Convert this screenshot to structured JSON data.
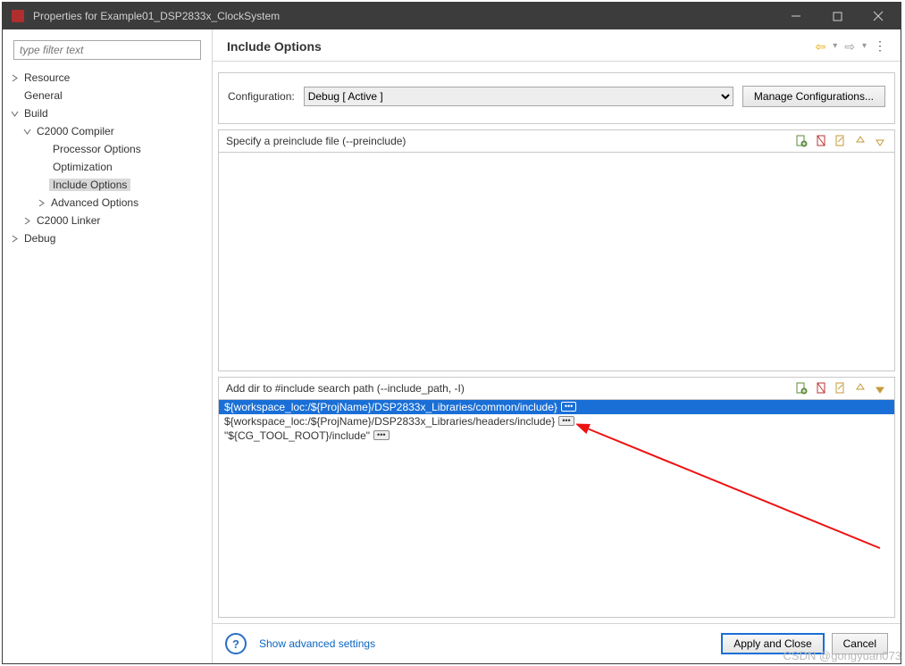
{
  "title": "Properties for Example01_DSP2833x_ClockSystem",
  "filter_placeholder": "type filter text",
  "tree": {
    "resource": "Resource",
    "general": "General",
    "build": "Build",
    "c2000_compiler": "C2000 Compiler",
    "processor_options": "Processor Options",
    "optimization": "Optimization",
    "include_options": "Include Options",
    "advanced_options": "Advanced Options",
    "c2000_linker": "C2000 Linker",
    "debug": "Debug"
  },
  "header": {
    "title": "Include Options"
  },
  "config": {
    "label": "Configuration:",
    "value": "Debug  [ Active ]",
    "manage": "Manage Configurations..."
  },
  "panel1": {
    "title": "Specify a preinclude file (--preinclude)"
  },
  "panel2": {
    "title": "Add dir to #include search path (--include_path, -I)",
    "rows": [
      "${workspace_loc:/${ProjName}/DSP2833x_Libraries/common/include}",
      "${workspace_loc:/${ProjName}/DSP2833x_Libraries/headers/include}",
      "\"${CG_TOOL_ROOT}/include\""
    ]
  },
  "footer": {
    "advanced": "Show advanced settings",
    "apply": "Apply and Close",
    "cancel": "Cancel"
  },
  "watermark": "CSDN @gongyuan073"
}
